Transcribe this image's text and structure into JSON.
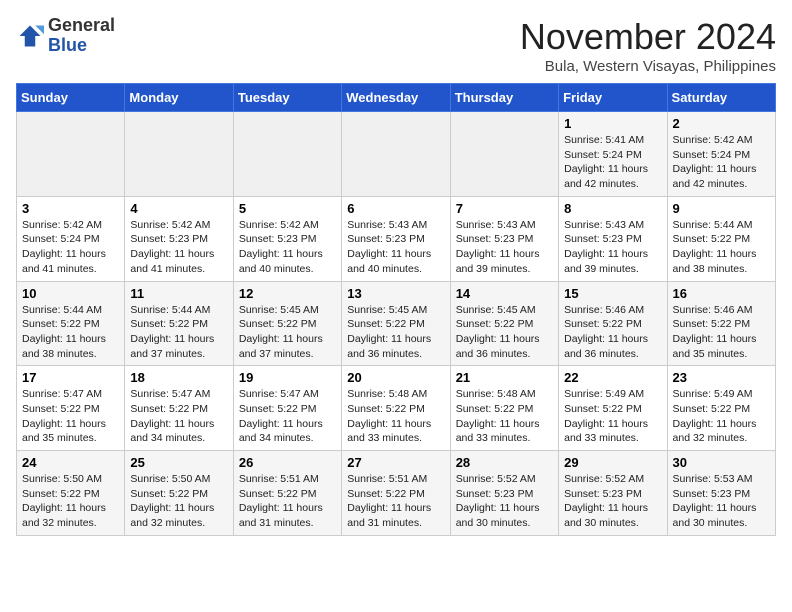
{
  "header": {
    "logo_line1": "General",
    "logo_line2": "Blue",
    "title": "November 2024",
    "subtitle": "Bula, Western Visayas, Philippines"
  },
  "weekdays": [
    "Sunday",
    "Monday",
    "Tuesday",
    "Wednesday",
    "Thursday",
    "Friday",
    "Saturday"
  ],
  "weeks": [
    [
      {
        "day": "",
        "sunrise": "",
        "sunset": "",
        "daylight": ""
      },
      {
        "day": "",
        "sunrise": "",
        "sunset": "",
        "daylight": ""
      },
      {
        "day": "",
        "sunrise": "",
        "sunset": "",
        "daylight": ""
      },
      {
        "day": "",
        "sunrise": "",
        "sunset": "",
        "daylight": ""
      },
      {
        "day": "",
        "sunrise": "",
        "sunset": "",
        "daylight": ""
      },
      {
        "day": "1",
        "sunrise": "Sunrise: 5:41 AM",
        "sunset": "Sunset: 5:24 PM",
        "daylight": "Daylight: 11 hours and 42 minutes."
      },
      {
        "day": "2",
        "sunrise": "Sunrise: 5:42 AM",
        "sunset": "Sunset: 5:24 PM",
        "daylight": "Daylight: 11 hours and 42 minutes."
      }
    ],
    [
      {
        "day": "3",
        "sunrise": "Sunrise: 5:42 AM",
        "sunset": "Sunset: 5:24 PM",
        "daylight": "Daylight: 11 hours and 41 minutes."
      },
      {
        "day": "4",
        "sunrise": "Sunrise: 5:42 AM",
        "sunset": "Sunset: 5:23 PM",
        "daylight": "Daylight: 11 hours and 41 minutes."
      },
      {
        "day": "5",
        "sunrise": "Sunrise: 5:42 AM",
        "sunset": "Sunset: 5:23 PM",
        "daylight": "Daylight: 11 hours and 40 minutes."
      },
      {
        "day": "6",
        "sunrise": "Sunrise: 5:43 AM",
        "sunset": "Sunset: 5:23 PM",
        "daylight": "Daylight: 11 hours and 40 minutes."
      },
      {
        "day": "7",
        "sunrise": "Sunrise: 5:43 AM",
        "sunset": "Sunset: 5:23 PM",
        "daylight": "Daylight: 11 hours and 39 minutes."
      },
      {
        "day": "8",
        "sunrise": "Sunrise: 5:43 AM",
        "sunset": "Sunset: 5:23 PM",
        "daylight": "Daylight: 11 hours and 39 minutes."
      },
      {
        "day": "9",
        "sunrise": "Sunrise: 5:44 AM",
        "sunset": "Sunset: 5:22 PM",
        "daylight": "Daylight: 11 hours and 38 minutes."
      }
    ],
    [
      {
        "day": "10",
        "sunrise": "Sunrise: 5:44 AM",
        "sunset": "Sunset: 5:22 PM",
        "daylight": "Daylight: 11 hours and 38 minutes."
      },
      {
        "day": "11",
        "sunrise": "Sunrise: 5:44 AM",
        "sunset": "Sunset: 5:22 PM",
        "daylight": "Daylight: 11 hours and 37 minutes."
      },
      {
        "day": "12",
        "sunrise": "Sunrise: 5:45 AM",
        "sunset": "Sunset: 5:22 PM",
        "daylight": "Daylight: 11 hours and 37 minutes."
      },
      {
        "day": "13",
        "sunrise": "Sunrise: 5:45 AM",
        "sunset": "Sunset: 5:22 PM",
        "daylight": "Daylight: 11 hours and 36 minutes."
      },
      {
        "day": "14",
        "sunrise": "Sunrise: 5:45 AM",
        "sunset": "Sunset: 5:22 PM",
        "daylight": "Daylight: 11 hours and 36 minutes."
      },
      {
        "day": "15",
        "sunrise": "Sunrise: 5:46 AM",
        "sunset": "Sunset: 5:22 PM",
        "daylight": "Daylight: 11 hours and 36 minutes."
      },
      {
        "day": "16",
        "sunrise": "Sunrise: 5:46 AM",
        "sunset": "Sunset: 5:22 PM",
        "daylight": "Daylight: 11 hours and 35 minutes."
      }
    ],
    [
      {
        "day": "17",
        "sunrise": "Sunrise: 5:47 AM",
        "sunset": "Sunset: 5:22 PM",
        "daylight": "Daylight: 11 hours and 35 minutes."
      },
      {
        "day": "18",
        "sunrise": "Sunrise: 5:47 AM",
        "sunset": "Sunset: 5:22 PM",
        "daylight": "Daylight: 11 hours and 34 minutes."
      },
      {
        "day": "19",
        "sunrise": "Sunrise: 5:47 AM",
        "sunset": "Sunset: 5:22 PM",
        "daylight": "Daylight: 11 hours and 34 minutes."
      },
      {
        "day": "20",
        "sunrise": "Sunrise: 5:48 AM",
        "sunset": "Sunset: 5:22 PM",
        "daylight": "Daylight: 11 hours and 33 minutes."
      },
      {
        "day": "21",
        "sunrise": "Sunrise: 5:48 AM",
        "sunset": "Sunset: 5:22 PM",
        "daylight": "Daylight: 11 hours and 33 minutes."
      },
      {
        "day": "22",
        "sunrise": "Sunrise: 5:49 AM",
        "sunset": "Sunset: 5:22 PM",
        "daylight": "Daylight: 11 hours and 33 minutes."
      },
      {
        "day": "23",
        "sunrise": "Sunrise: 5:49 AM",
        "sunset": "Sunset: 5:22 PM",
        "daylight": "Daylight: 11 hours and 32 minutes."
      }
    ],
    [
      {
        "day": "24",
        "sunrise": "Sunrise: 5:50 AM",
        "sunset": "Sunset: 5:22 PM",
        "daylight": "Daylight: 11 hours and 32 minutes."
      },
      {
        "day": "25",
        "sunrise": "Sunrise: 5:50 AM",
        "sunset": "Sunset: 5:22 PM",
        "daylight": "Daylight: 11 hours and 32 minutes."
      },
      {
        "day": "26",
        "sunrise": "Sunrise: 5:51 AM",
        "sunset": "Sunset: 5:22 PM",
        "daylight": "Daylight: 11 hours and 31 minutes."
      },
      {
        "day": "27",
        "sunrise": "Sunrise: 5:51 AM",
        "sunset": "Sunset: 5:22 PM",
        "daylight": "Daylight: 11 hours and 31 minutes."
      },
      {
        "day": "28",
        "sunrise": "Sunrise: 5:52 AM",
        "sunset": "Sunset: 5:23 PM",
        "daylight": "Daylight: 11 hours and 30 minutes."
      },
      {
        "day": "29",
        "sunrise": "Sunrise: 5:52 AM",
        "sunset": "Sunset: 5:23 PM",
        "daylight": "Daylight: 11 hours and 30 minutes."
      },
      {
        "day": "30",
        "sunrise": "Sunrise: 5:53 AM",
        "sunset": "Sunset: 5:23 PM",
        "daylight": "Daylight: 11 hours and 30 minutes."
      }
    ]
  ]
}
